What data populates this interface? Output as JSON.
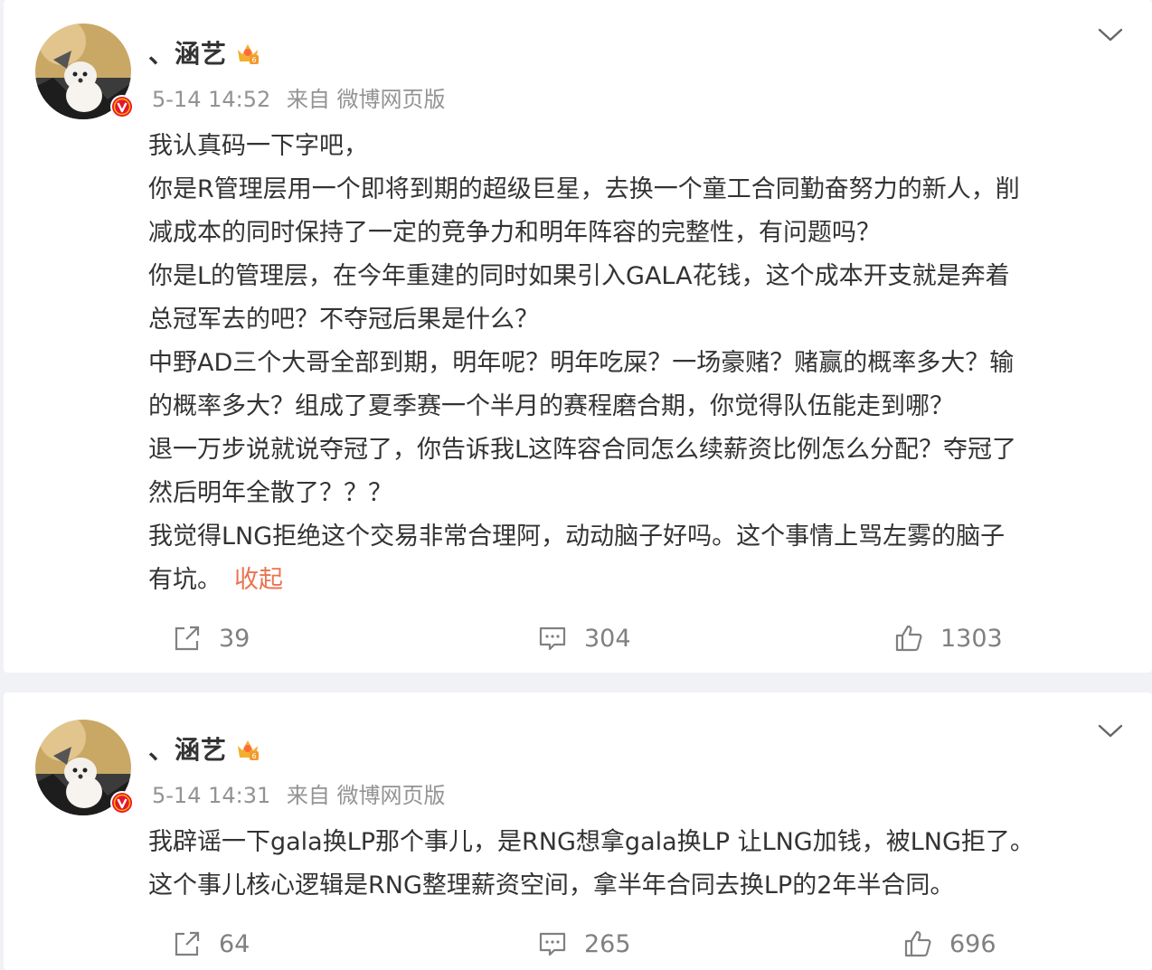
{
  "posts": [
    {
      "author": {
        "name": "、涵艺"
      },
      "meta": {
        "time": "5-14 14:52",
        "source": "来自 微博网页版"
      },
      "text_lines": [
        "我认真码一下字吧，",
        "你是R管理层用一个即将到期的超级巨星，去换一个童工合同勤奋努力的新人，削",
        "减成本的同时保持了一定的竞争力和明年阵容的完整性，有问题吗？",
        "你是L的管理层，在今年重建的同时如果引入GALA花钱，这个成本开支就是奔着",
        "总冠军去的吧？不夺冠后果是什么？",
        "中野AD三个大哥全部到期，明年呢？明年吃屎？一场豪赌？赌赢的概率多大？输",
        "的概率多大？组成了夏季赛一个半月的赛程磨合期，你觉得队伍能走到哪？",
        "退一万步说就说夺冠了，你告诉我L这阵容合同怎么续薪资比例怎么分配？夺冠了",
        "然后明年全散了？？？",
        " 我觉得LNG拒绝这个交易非常合理阿，动动脑子好吗。这个事情上骂左雾的脑子",
        "有坑。"
      ],
      "collapse_label": "收起",
      "actions": {
        "shares": "39",
        "comments": "304",
        "likes": "1303"
      }
    },
    {
      "author": {
        "name": "、涵艺"
      },
      "meta": {
        "time": "5-14 14:31",
        "source": "来自 微博网页版"
      },
      "text_lines": [
        "我辟谣一下gala换LP那个事儿，是RNG想拿gala换LP 让LNG加钱，被LNG拒了。",
        "这个事儿核心逻辑是RNG整理薪资空间，拿半年合同去换LP的2年半合同。"
      ],
      "actions": {
        "shares": "64",
        "comments": "265",
        "likes": "696"
      }
    }
  ],
  "colors": {
    "background": "#f1f2f5",
    "text": "#333333",
    "meta": "#939393",
    "link": "#eb7350",
    "verified": "#e6162d",
    "icon": "#808080"
  },
  "icons": {
    "menu": "chevron-down-icon",
    "share": "share-icon",
    "comment": "comment-icon",
    "like": "thumbs-up-icon",
    "verified": "verified-badge-icon",
    "vip": "vip-crown-icon"
  }
}
